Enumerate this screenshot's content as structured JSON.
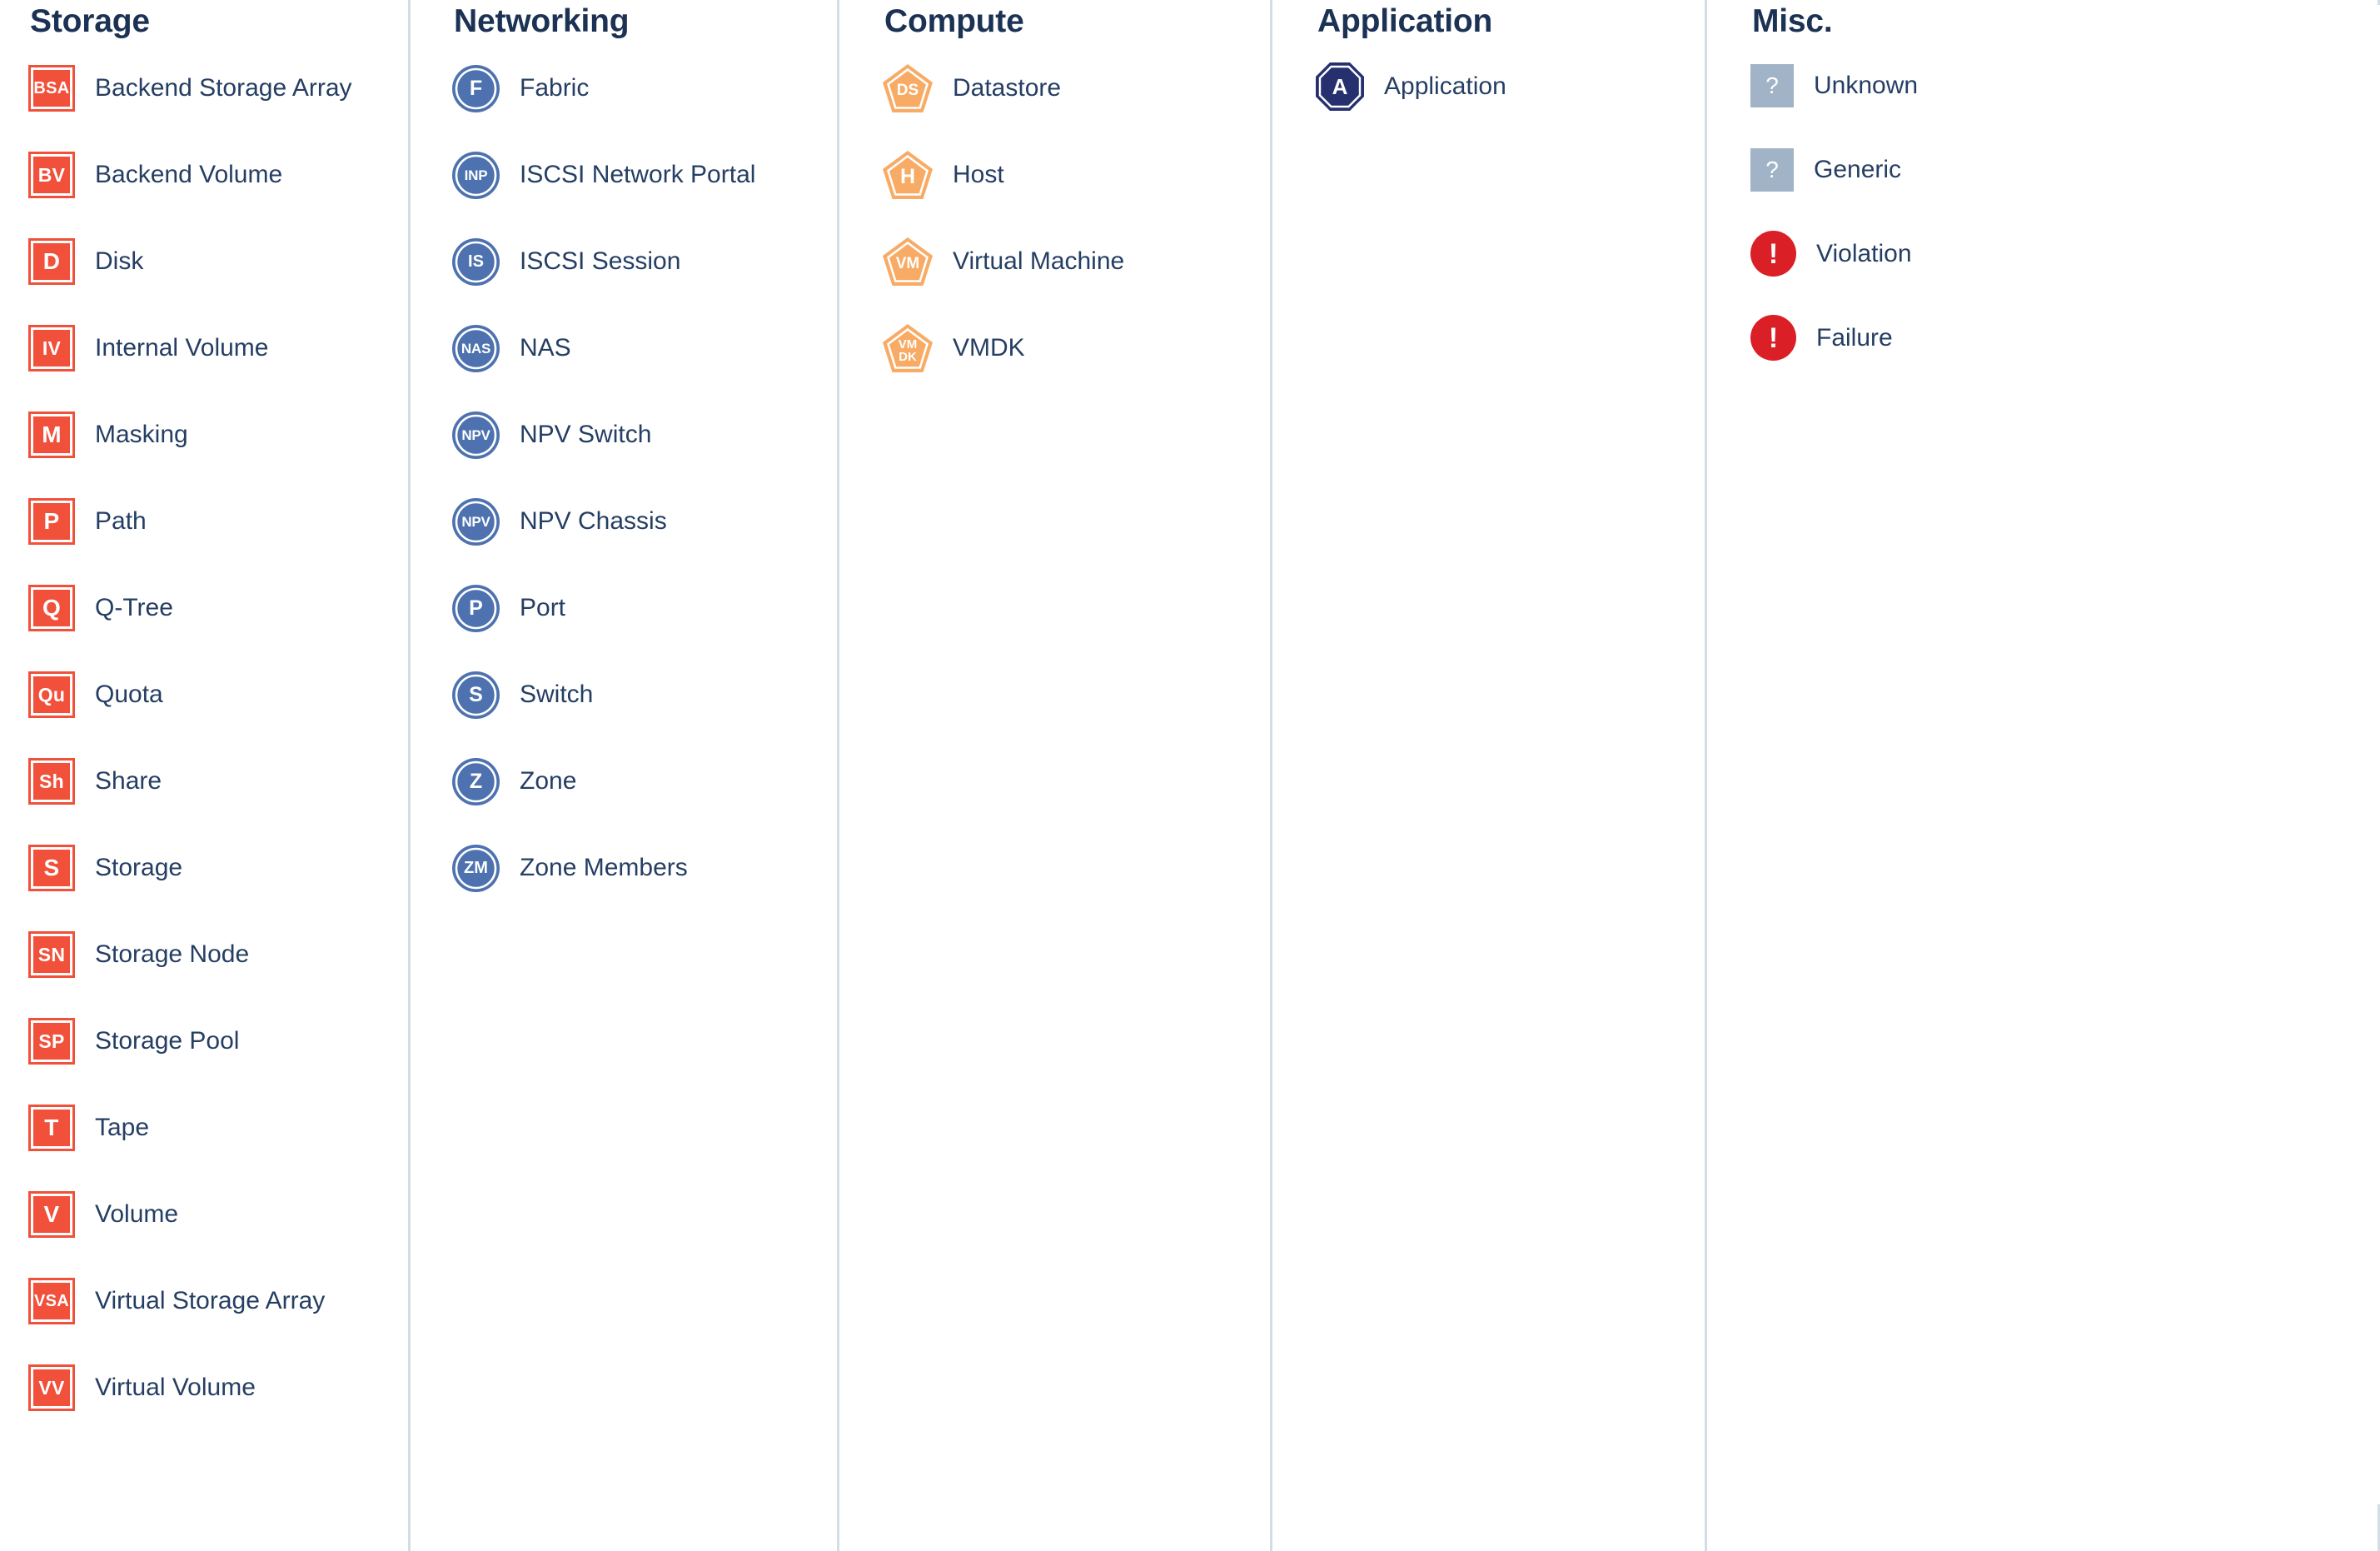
{
  "palette": {
    "storage_fill": "#F1503A",
    "networking_fill": "#4E72AF",
    "compute_fill": "#F8AB65",
    "application_fill": "#26306E",
    "misc_unknown_fill": "#A1B3C6",
    "misc_alert_fill": "#DA1F26",
    "divider": "#D3DDE8",
    "label_text": "#253E63",
    "heading_text": "#1C3254",
    "glyph_text": "#FFFFFF"
  },
  "columns": [
    {
      "id": "storage",
      "title": "Storage",
      "icon_style": "square",
      "items": [
        {
          "abbr": "BSA",
          "label": "Backend Storage Array"
        },
        {
          "abbr": "BV",
          "label": "Backend Volume"
        },
        {
          "abbr": "D",
          "label": "Disk"
        },
        {
          "abbr": "IV",
          "label": "Internal Volume"
        },
        {
          "abbr": "M",
          "label": "Masking"
        },
        {
          "abbr": "P",
          "label": "Path"
        },
        {
          "abbr": "Q",
          "label": "Q-Tree"
        },
        {
          "abbr": "Qu",
          "label": "Quota"
        },
        {
          "abbr": "Sh",
          "label": "Share"
        },
        {
          "abbr": "S",
          "label": "Storage"
        },
        {
          "abbr": "SN",
          "label": "Storage Node"
        },
        {
          "abbr": "SP",
          "label": "Storage Pool"
        },
        {
          "abbr": "T",
          "label": "Tape"
        },
        {
          "abbr": "V",
          "label": "Volume"
        },
        {
          "abbr": "VSA",
          "label": "Virtual Storage Array"
        },
        {
          "abbr": "VV",
          "label": "Virtual Volume"
        }
      ]
    },
    {
      "id": "networking",
      "title": "Networking",
      "icon_style": "circle",
      "items": [
        {
          "abbr": "F",
          "label": "Fabric"
        },
        {
          "abbr": "INP",
          "label": "ISCSI Network Portal"
        },
        {
          "abbr": "IS",
          "label": "ISCSI Session"
        },
        {
          "abbr": "NAS",
          "label": "NAS"
        },
        {
          "abbr": "NPV",
          "label": "NPV Switch"
        },
        {
          "abbr": "NPV",
          "label": "NPV Chassis"
        },
        {
          "abbr": "P",
          "label": "Port"
        },
        {
          "abbr": "S",
          "label": "Switch"
        },
        {
          "abbr": "Z",
          "label": "Zone"
        },
        {
          "abbr": "ZM",
          "label": "Zone Members"
        }
      ]
    },
    {
      "id": "compute",
      "title": "Compute",
      "icon_style": "pentagon",
      "items": [
        {
          "abbr": "DS",
          "label": "Datastore"
        },
        {
          "abbr": "H",
          "label": "Host"
        },
        {
          "abbr": "VM",
          "label": "Virtual Machine"
        },
        {
          "abbr": "VM DK",
          "abbr_lines": [
            "VM",
            "DK"
          ],
          "label": "VMDK"
        }
      ]
    },
    {
      "id": "application",
      "title": "Application",
      "icon_style": "octagon",
      "items": [
        {
          "abbr": "A",
          "label": "Application"
        }
      ]
    },
    {
      "id": "misc",
      "title": "Misc.",
      "icon_style": "mixed",
      "items": [
        {
          "abbr": "?",
          "label": "Unknown",
          "icon_style": "flatsquare"
        },
        {
          "abbr": "?",
          "label": "Generic",
          "icon_style": "flatsquare"
        },
        {
          "abbr": "!",
          "label": "Violation",
          "icon_style": "alert"
        },
        {
          "abbr": "!",
          "label": "Failure",
          "icon_style": "alert"
        }
      ]
    }
  ]
}
